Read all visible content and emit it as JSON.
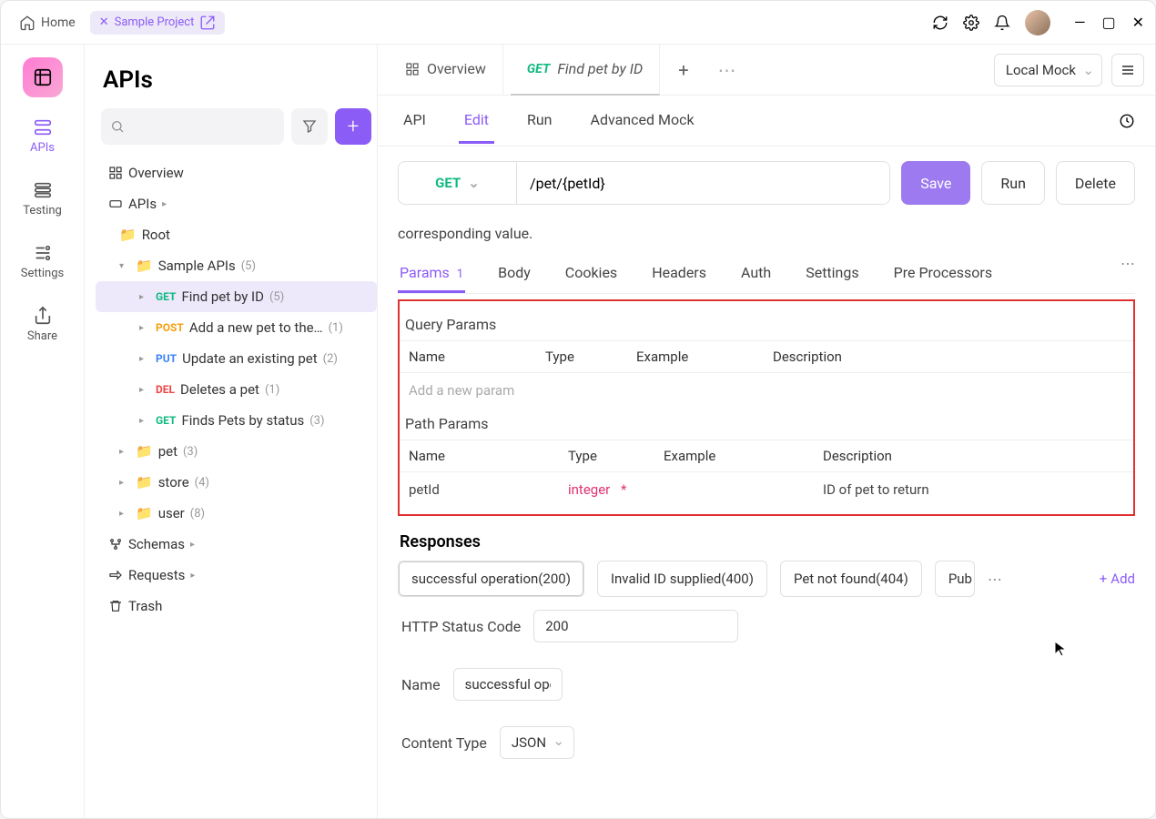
{
  "titlebar": {
    "home": "Home",
    "project_tab": "Sample Project"
  },
  "navrail": {
    "items": [
      {
        "label": "APIs"
      },
      {
        "label": "Testing"
      },
      {
        "label": "Settings"
      },
      {
        "label": "Share"
      }
    ]
  },
  "sidebar": {
    "title": "APIs",
    "overview": "Overview",
    "apis_label": "APIs",
    "root": "Root",
    "sample_apis": {
      "label": "Sample APIs",
      "count": "(5)"
    },
    "endpoints": [
      {
        "method": "GET",
        "label": "Find pet by ID",
        "count": "(5)"
      },
      {
        "method": "POST",
        "label": "Add a new pet to the…",
        "count": "(1)"
      },
      {
        "method": "PUT",
        "label": "Update an existing pet",
        "count": "(2)"
      },
      {
        "method": "DEL",
        "label": "Deletes a pet",
        "count": "(1)"
      },
      {
        "method": "GET",
        "label": "Finds Pets by status",
        "count": "(3)"
      }
    ],
    "folders": [
      {
        "label": "pet",
        "count": "(3)"
      },
      {
        "label": "store",
        "count": "(4)"
      },
      {
        "label": "user",
        "count": "(8)"
      }
    ],
    "schemas": "Schemas",
    "requests": "Requests",
    "trash": "Trash"
  },
  "tabs": {
    "overview": "Overview",
    "active_method": "GET",
    "active_label": "Find pet by ID",
    "env": "Local Mock"
  },
  "subtabs": {
    "api": "API",
    "edit": "Edit",
    "run": "Run",
    "mock": "Advanced Mock"
  },
  "url_row": {
    "method": "GET",
    "path": "/pet/{petId}",
    "save": "Save",
    "run": "Run",
    "delete": "Delete"
  },
  "desc": "corresponding value.",
  "param_tabs": {
    "params": "Params",
    "params_count": "1",
    "body": "Body",
    "cookies": "Cookies",
    "headers": "Headers",
    "auth": "Auth",
    "settings": "Settings",
    "pre": "Pre Processors"
  },
  "query_params": {
    "title": "Query Params",
    "cols": {
      "name": "Name",
      "type": "Type",
      "example": "Example",
      "desc": "Description"
    },
    "placeholder": "Add a new param"
  },
  "path_params": {
    "title": "Path Params",
    "cols": {
      "name": "Name",
      "type": "Type",
      "example": "Example",
      "desc": "Description"
    },
    "row": {
      "name": "petId",
      "type": "integer",
      "example": "",
      "desc": "ID of pet to return"
    }
  },
  "responses": {
    "title": "Responses",
    "tabs": [
      "successful operation(200)",
      "Invalid ID supplied(400)",
      "Pet not found(404)",
      "Pub"
    ],
    "add": "Add",
    "status_label": "HTTP Status Code",
    "status_value": "200",
    "name_label": "Name",
    "name_value": "successful oper",
    "ct_label": "Content Type",
    "ct_value": "JSON"
  }
}
